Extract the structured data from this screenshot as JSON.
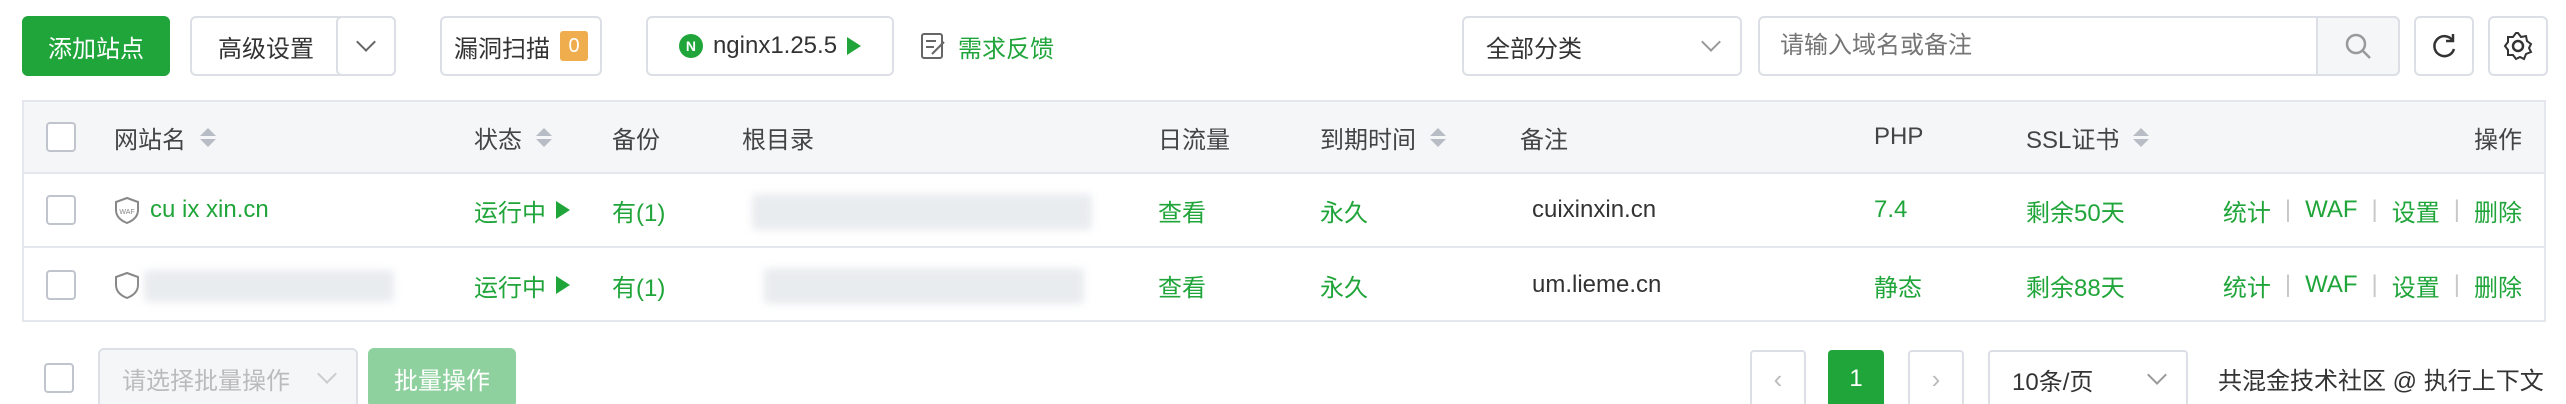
{
  "toolbar": {
    "add_site": "添加站点",
    "advanced_settings": "高级设置",
    "vuln_scan": "漏洞扫描",
    "vuln_count": "0",
    "nginx_version": "nginx1.25.5",
    "feedback": "需求反馈",
    "category_select": "全部分类",
    "search_placeholder": "请输入域名或备注"
  },
  "table": {
    "headers": {
      "site_name": "网站名",
      "status": "状态",
      "backup": "备份",
      "root_dir": "根目录",
      "traffic": "日流量",
      "expire": "到期时间",
      "remark": "备注",
      "php": "PHP",
      "ssl": "SSL证书",
      "actions": "操作"
    },
    "rows": [
      {
        "site_name": "cu ix    xin.cn",
        "status": "运行中",
        "backup": "有(1)",
        "traffic": "查看",
        "expire": "永久",
        "remark": "cuixinxin.cn",
        "php": "7.4",
        "ssl": "剩余50天",
        "act_stats": "统计",
        "act_waf": "WAF",
        "act_settings": "设置",
        "act_delete": "删除"
      },
      {
        "site_name": "",
        "status": "运行中",
        "backup": "有(1)",
        "traffic": "查看",
        "expire": "永久",
        "remark": "um.lieme.cn",
        "php": "静态",
        "ssl": "剩余88天",
        "act_stats": "统计",
        "act_waf": "WAF",
        "act_settings": "设置",
        "act_delete": "删除"
      }
    ]
  },
  "footer": {
    "batch_placeholder": "请选择批量操作",
    "batch_button": "批量操作",
    "current_page": "1",
    "page_size": "10条/页",
    "watermark": "共混金技术社区 @ 执行上下文"
  },
  "colors": {
    "accent_green": "#20a53a",
    "badge_orange": "#f0ad4e"
  }
}
